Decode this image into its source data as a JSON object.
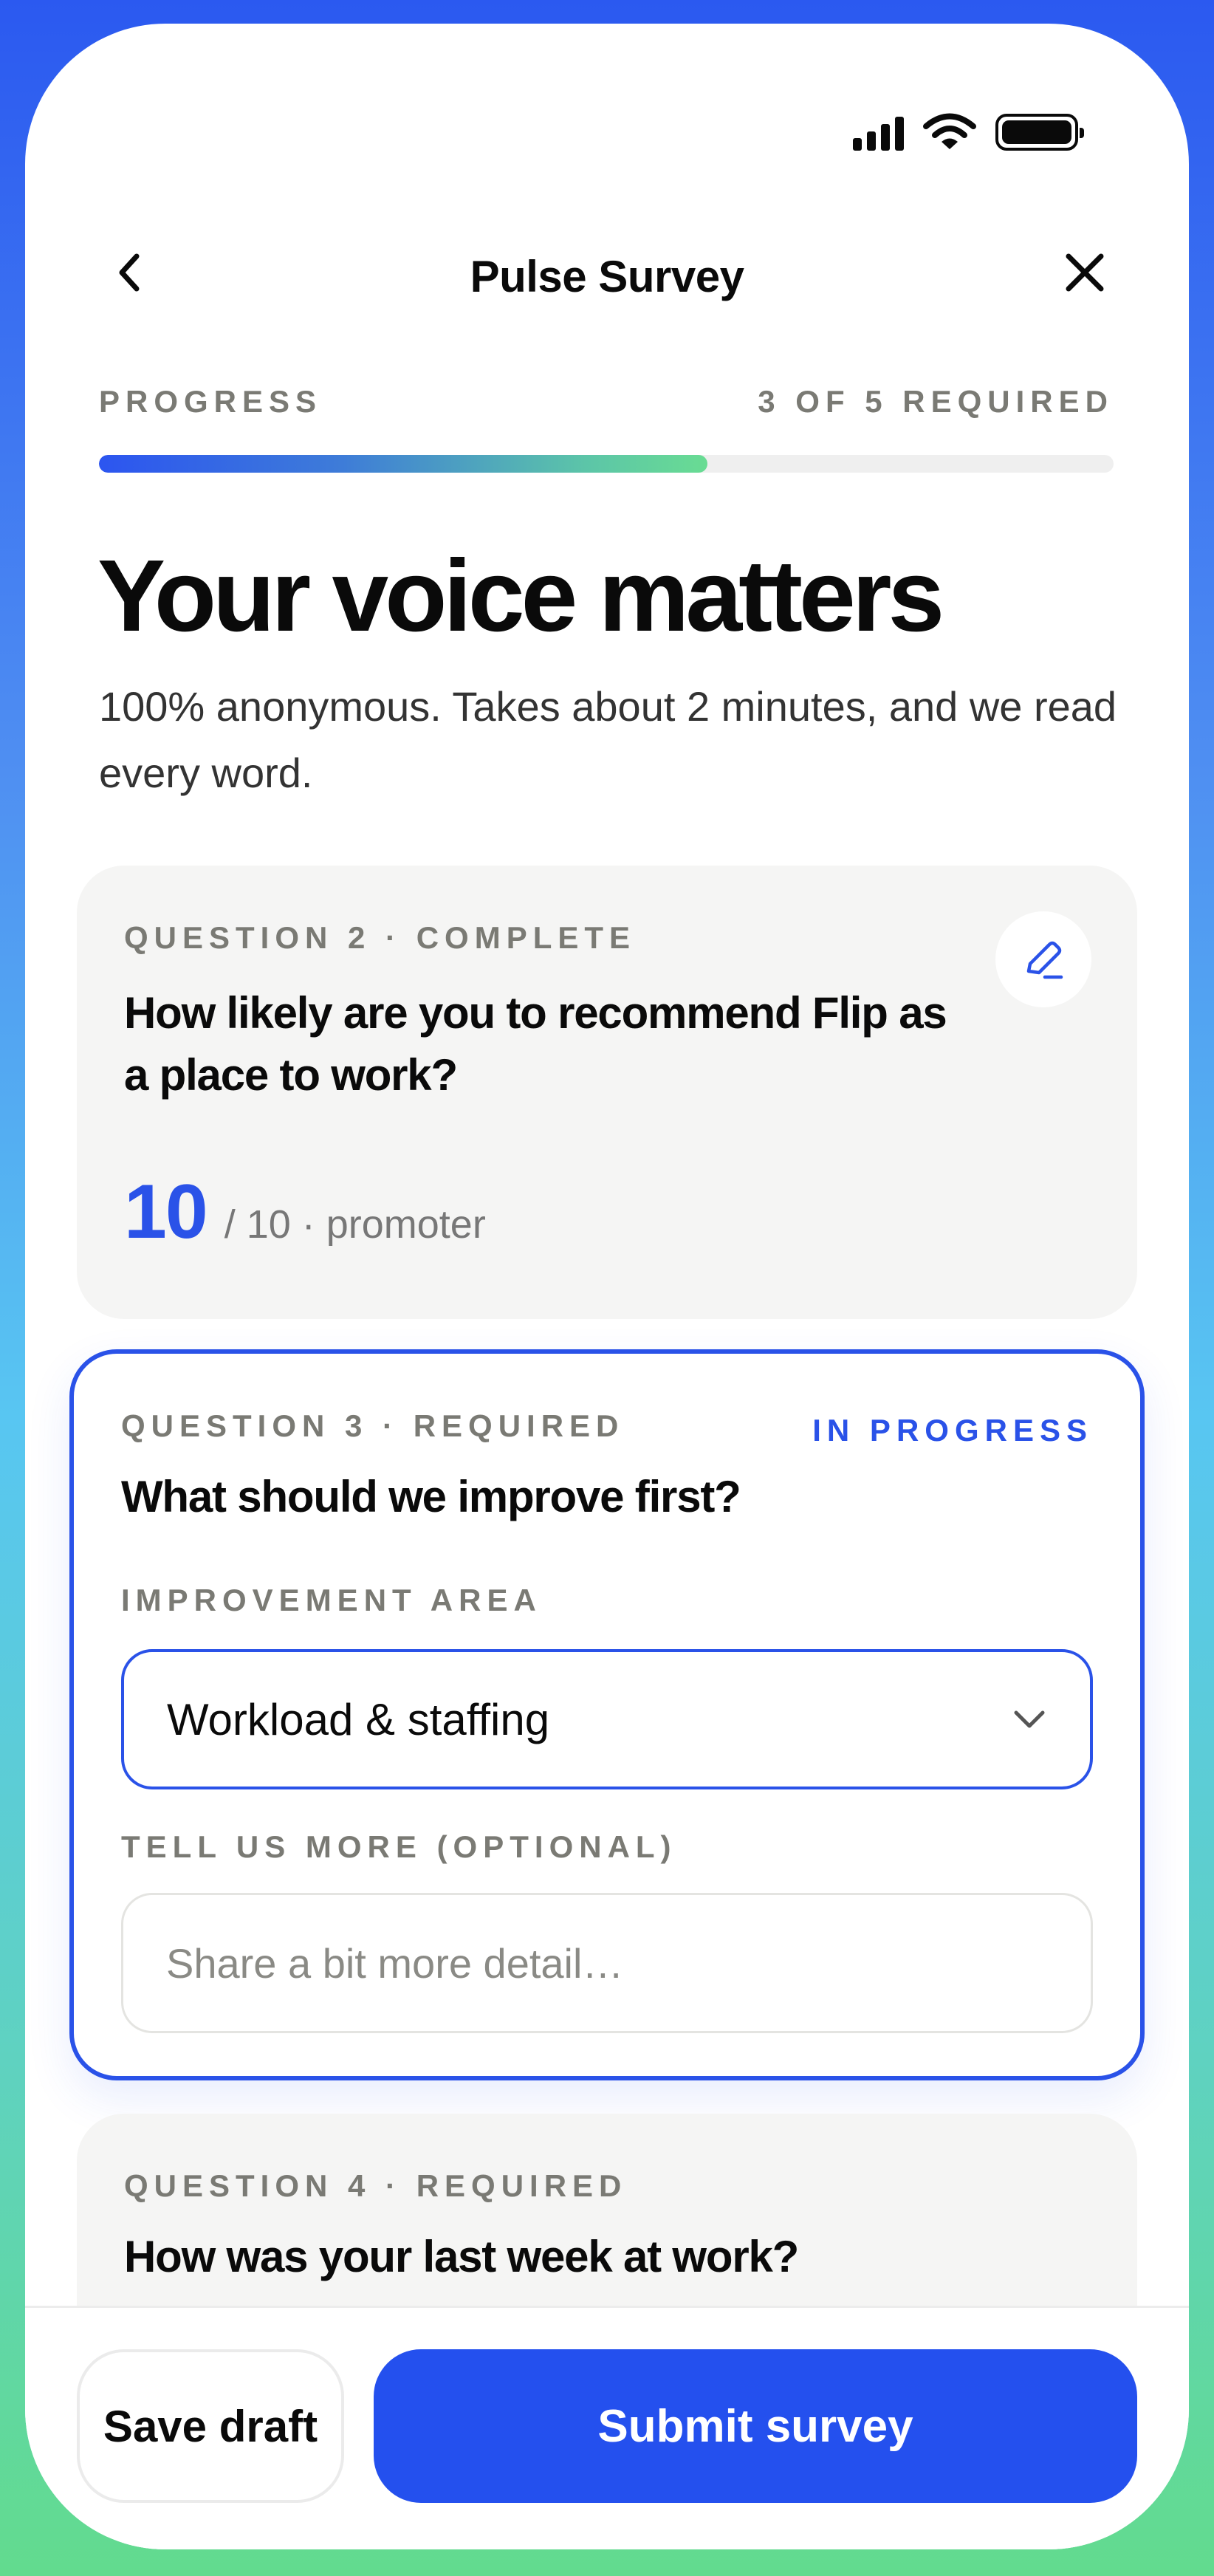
{
  "header": {
    "title": "Pulse Survey",
    "back_icon": "chevron-left-icon",
    "close_icon": "close-icon"
  },
  "status_bar": {
    "icons": [
      "signal-icon",
      "wifi-icon",
      "battery-icon"
    ]
  },
  "progress": {
    "label": "PROGRESS",
    "count_label": "3 OF 5 REQUIRED",
    "completed": 3,
    "total": 5,
    "fill_fraction": 0.6
  },
  "hero": {
    "title": "Your voice matters",
    "subtitle": "100% anonymous. Takes about 2 minutes, and we read every word."
  },
  "questions": [
    {
      "eyebrow": "QUESTION 2 · COMPLETE",
      "text": "How likely are you to recommend Flip as a place to work?",
      "score": "10",
      "score_suffix": "/ 10 · promoter",
      "edit_icon": "pencil-icon"
    },
    {
      "eyebrow": "QUESTION 3 · REQUIRED",
      "status": "IN PROGRESS",
      "text": "What should we improve first?",
      "area_label": "IMPROVEMENT AREA",
      "area_value": "Workload & staffing",
      "more_label": "TELL US MORE (OPTIONAL)",
      "more_placeholder": "Share a bit more detail…",
      "more_value": ""
    },
    {
      "eyebrow": "QUESTION 4 · REQUIRED",
      "text": "How was your last week at work?"
    }
  ],
  "actions": {
    "save_label": "Save draft",
    "submit_label": "Submit survey"
  },
  "colors": {
    "accent": "#2a52e8",
    "submit": "#2450ee",
    "frame_top": "#2b59f0",
    "frame_bottom": "#62db8e",
    "progress_end": "#69dc93"
  }
}
